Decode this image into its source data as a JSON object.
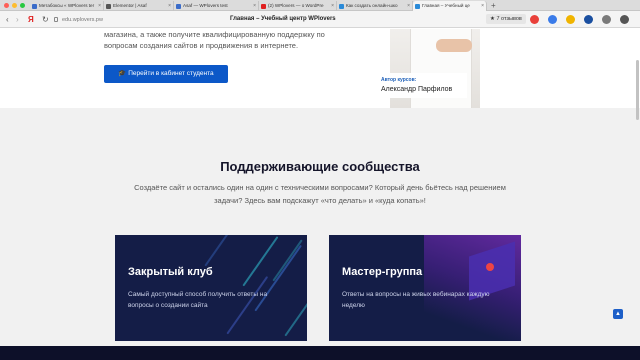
{
  "browser": {
    "tabs": [
      {
        "label": "Метабоксы « WPlovers ter",
        "favicon_color": "#3b6cc9"
      },
      {
        "label": "Elementor | Asaf",
        "favicon_color": "#555555"
      },
      {
        "label": "Asaf — WPlovers test",
        "favicon_color": "#3b6cc9"
      },
      {
        "label": "(2) WPlovers — о WordPre",
        "favicon_color": "#e02020"
      },
      {
        "label": "Как создать онлайн-шко",
        "favicon_color": "#2a8ad8"
      },
      {
        "label": "Главная – Учебный це",
        "favicon_color": "#2a8ad8"
      }
    ],
    "new_tab": "+",
    "close_glyph": "×",
    "nav": {
      "back": "‹",
      "forward": "›",
      "yandex": "Я",
      "reload": "↻"
    },
    "url": "edu.wplovers.pw",
    "page_title": "Главная – Учебный центр WPlovers",
    "reviews": "★ 7 отзывов"
  },
  "hero": {
    "line1": "магазина, а также получите квалифицированную поддержку по",
    "line2": "вопросам создания сайтов и продвижения в интернете.",
    "cta_label": "🎓 Перейти в кабинет студента",
    "author_kicker": "Автор курсов:",
    "author_name": "Александр Парфилов"
  },
  "section": {
    "title": "Поддерживающие сообщества",
    "subtitle_line1": "Создаёте сайт и остались один на один с техническими вопросами? Который день бьётесь над решением",
    "subtitle_line2": "задачи? Здесь вам подскажут «что делать» и «куда копать»!"
  },
  "cards": [
    {
      "title": "Закрытый клуб",
      "text": "Самый доступный способ получить ответы на вопросы о создании сайта"
    },
    {
      "title": "Мастер-группа",
      "text": "Ответы на вопросы на живых вебинарах каждую неделю"
    }
  ],
  "scroll_top_glyph": "▲",
  "colors": {
    "accent": "#0c58c8",
    "card_bg": "#141d47",
    "section_bg": "#f1f1f1",
    "footer": "#0d1029"
  }
}
